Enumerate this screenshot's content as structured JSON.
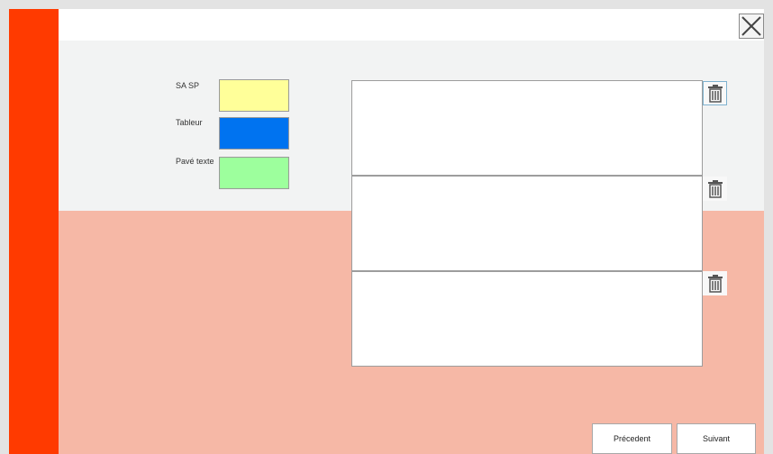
{
  "legend": {
    "items": [
      {
        "label": "SA SP",
        "color": "#ffff99"
      },
      {
        "label": "Tableur",
        "color": "#0073f0"
      },
      {
        "label": "Pavé texte",
        "color": "#9dff9d"
      }
    ]
  },
  "colors": {
    "sidebar": "#ff3a00",
    "panel_bottom": "#f6b8a6",
    "panel_top": "#f2f3f3"
  },
  "icons": {
    "close": "close-icon",
    "delete": "trash-icon"
  },
  "nav": {
    "previous_label": "Précedent",
    "next_label": "Suivant"
  }
}
